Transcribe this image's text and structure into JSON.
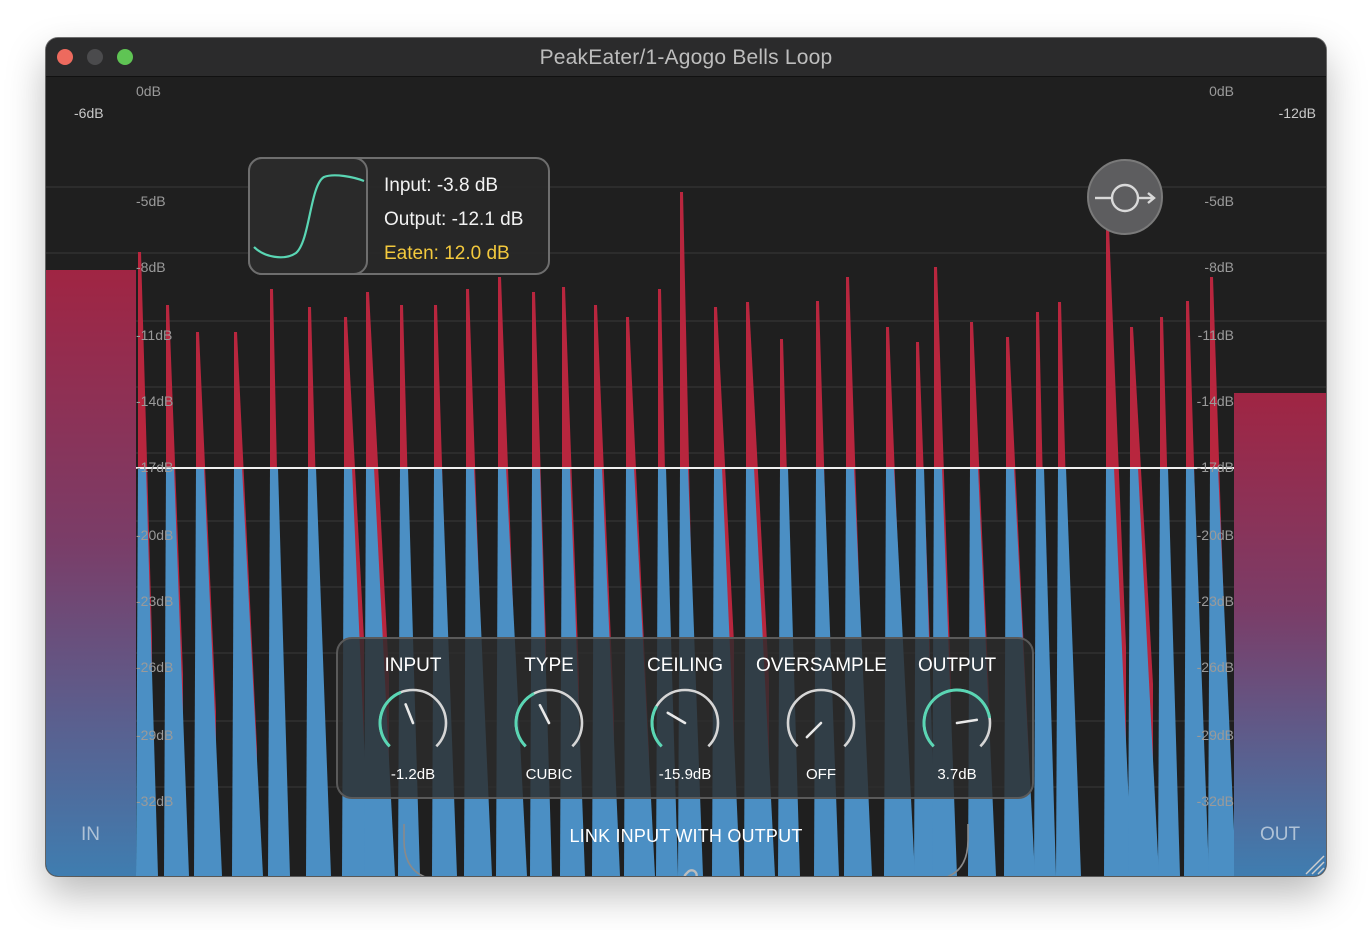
{
  "window": {
    "title": "PeakEater/1-Agogo Bells Loop"
  },
  "scale": {
    "left_labels": [
      "0dB",
      "-5dB",
      "-8dB",
      "-11dB",
      "-14dB",
      "-17dB",
      "-20dB",
      "-23dB",
      "-26dB",
      "-29dB",
      "-32dB"
    ],
    "right_labels": [
      "0dB",
      "-5dB",
      "-8dB",
      "-11dB",
      "-14dB",
      "-17dB",
      "-20dB",
      "-23dB",
      "-26dB",
      "-29dB",
      "-32dB"
    ]
  },
  "meters": {
    "in": {
      "label": "IN",
      "peak_label": "-6dB",
      "level_db": -6
    },
    "out": {
      "label": "OUT",
      "peak_label": "-12dB",
      "level_db": -12
    }
  },
  "info": {
    "input": "Input: -3.8 dB",
    "output": "Output: -12.1 dB",
    "eaten": "Eaten: 12.0 dB"
  },
  "knobs": [
    {
      "title": "INPUT",
      "value": "-1.2dB",
      "position": 0.42
    },
    {
      "title": "TYPE",
      "value": "CUBIC",
      "position": 0.4
    },
    {
      "title": "CEILING",
      "value": "-15.9dB",
      "position": 0.28
    },
    {
      "title": "OVERSAMPLE",
      "value": "OFF",
      "position": 0.0
    },
    {
      "title": "OUTPUT",
      "value": "3.7dB",
      "position": 0.8
    }
  ],
  "link": {
    "label": "LINK INPUT WITH OUTPUT"
  },
  "icons": {
    "bypass": "bypass-icon",
    "link": "link-icon",
    "resize": "resize-grip-icon"
  },
  "colors": {
    "waveform_blue": "#4b8fc4",
    "eaten_red": "#b8263e",
    "accent_teal": "#5ad6b4",
    "eaten_text": "#f3c93d"
  }
}
